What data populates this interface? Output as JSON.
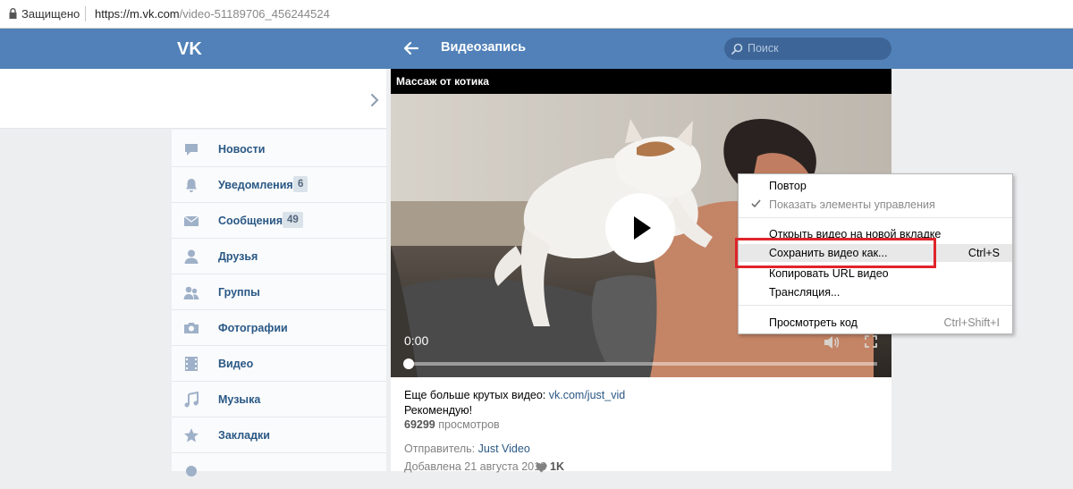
{
  "browser": {
    "secure_label": "Защищено",
    "url_main": "https://m.vk.com",
    "url_path": "/video-51189706_456244524"
  },
  "header": {
    "title": "Видеозапись",
    "search_placeholder": "Поиск",
    "brand_color": "#5181b8"
  },
  "sidebar": {
    "items": [
      {
        "label": "Новости",
        "icon": "news-icon",
        "badge": ""
      },
      {
        "label": "Уведомления",
        "icon": "bell-icon",
        "badge": "6"
      },
      {
        "label": "Сообщения",
        "icon": "envelope-icon",
        "badge": "49"
      },
      {
        "label": "Друзья",
        "icon": "person-icon",
        "badge": ""
      },
      {
        "label": "Группы",
        "icon": "group-icon",
        "badge": ""
      },
      {
        "label": "Фотографии",
        "icon": "camera-icon",
        "badge": ""
      },
      {
        "label": "Видео",
        "icon": "film-icon",
        "badge": ""
      },
      {
        "label": "Музыка",
        "icon": "music-note-icon",
        "badge": ""
      },
      {
        "label": "Закладки",
        "icon": "star-icon",
        "badge": ""
      }
    ]
  },
  "video": {
    "title": "Массаж от котика",
    "time": "0:00",
    "progress": 0,
    "description_prefix": "Еще больше крутых видео: ",
    "description_link": "vk.com/just_vid",
    "description_line2": "Рекомендую!",
    "views_count": "69299",
    "views_label": " просмотров",
    "sender_label": "Отправитель: ",
    "sender_name": "Just Video",
    "added_text": "Добавлена 21 августа 2018",
    "likes": "1K"
  },
  "context_menu": {
    "items": [
      {
        "label": "Повтор",
        "shortcut": "",
        "disabled": false,
        "checked": false
      },
      {
        "label": "Показать элементы управления",
        "shortcut": "",
        "disabled": true,
        "checked": true
      },
      {
        "label": "Открыть видео на новой вкладке",
        "shortcut": "",
        "disabled": false,
        "checked": false
      },
      {
        "label": "Сохранить видео как...",
        "shortcut": "Ctrl+S",
        "disabled": false,
        "checked": false,
        "highlighted": true
      },
      {
        "label": "Копировать URL видео",
        "shortcut": "",
        "disabled": false,
        "checked": false
      },
      {
        "label": "Трансляция...",
        "shortcut": "",
        "disabled": false,
        "checked": false
      },
      {
        "label": "Просмотреть код",
        "shortcut": "Ctrl+Shift+I",
        "disabled": true,
        "checked": false
      }
    ],
    "highlight_color": "#e0242a"
  }
}
